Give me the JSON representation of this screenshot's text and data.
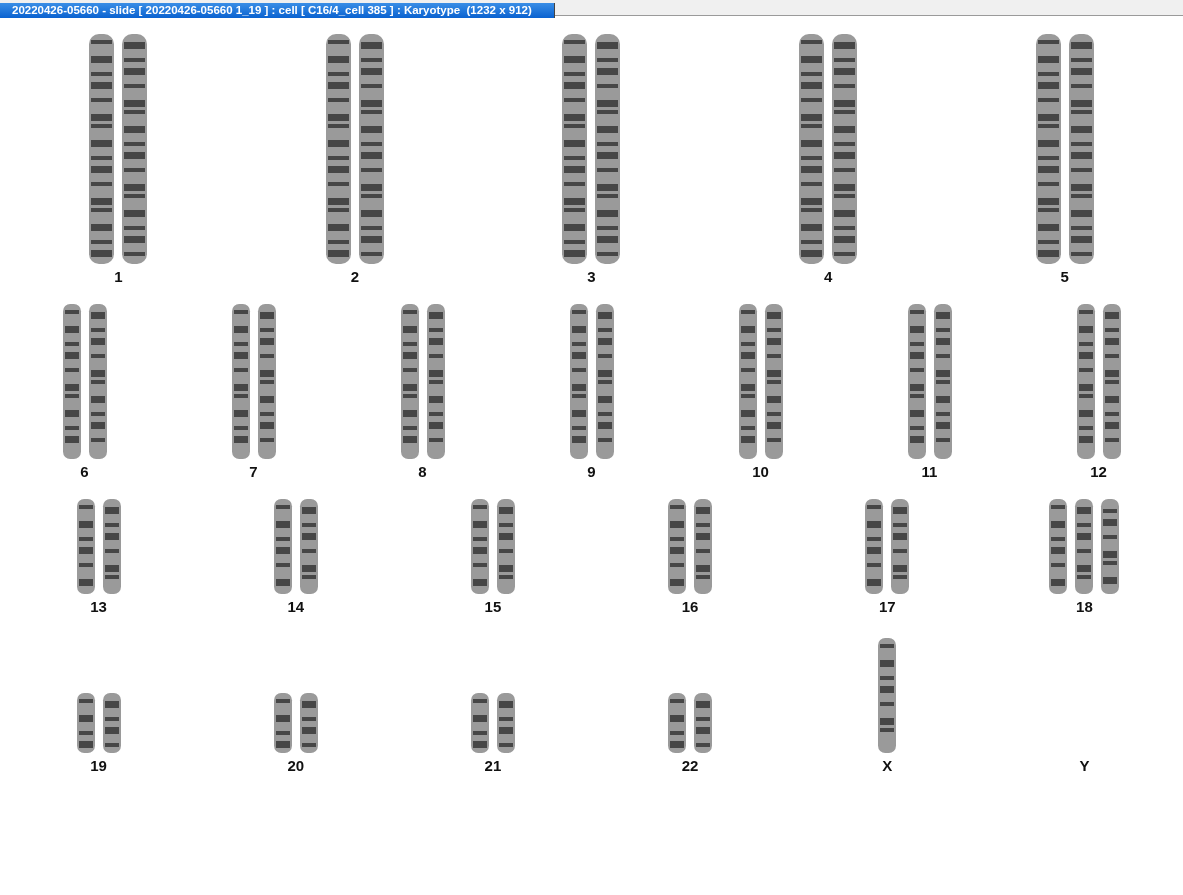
{
  "window": {
    "title": "20220426-05660 - slide [ 20220426-05660 1_19 ] : cell [ C16/4_cell 385 ] : Karyotype  (1232 x 912)"
  },
  "karyotype": {
    "rows": [
      {
        "groups": [
          {
            "label": "1",
            "kind": "pair"
          },
          {
            "label": "2",
            "kind": "pair"
          },
          {
            "label": "3",
            "kind": "pair"
          },
          {
            "label": "4",
            "kind": "pair"
          },
          {
            "label": "5",
            "kind": "pair"
          }
        ]
      },
      {
        "groups": [
          {
            "label": "6",
            "kind": "pair"
          },
          {
            "label": "7",
            "kind": "pair"
          },
          {
            "label": "8",
            "kind": "pair"
          },
          {
            "label": "9",
            "kind": "pair"
          },
          {
            "label": "10",
            "kind": "pair"
          },
          {
            "label": "11",
            "kind": "pair"
          },
          {
            "label": "12",
            "kind": "pair"
          }
        ]
      },
      {
        "groups": [
          {
            "label": "13",
            "kind": "pair"
          },
          {
            "label": "14",
            "kind": "pair"
          },
          {
            "label": "15",
            "kind": "pair"
          },
          {
            "label": "16",
            "kind": "pair"
          },
          {
            "label": "17",
            "kind": "pair"
          },
          {
            "label": "18",
            "kind": "triple"
          }
        ]
      },
      {
        "groups": [
          {
            "label": "19",
            "kind": "pair"
          },
          {
            "label": "20",
            "kind": "pair"
          },
          {
            "label": "21",
            "kind": "pair"
          },
          {
            "label": "22",
            "kind": "pair"
          },
          {
            "label": "X",
            "kind": "single"
          },
          {
            "label": "Y",
            "kind": "none"
          }
        ]
      }
    ]
  }
}
